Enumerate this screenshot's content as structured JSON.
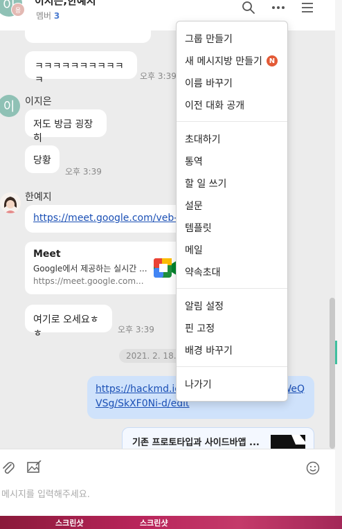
{
  "header": {
    "title": "이지은,한예지",
    "member_label": "멤버",
    "member_count": "3",
    "avatar_main": "이",
    "avatar_sub": "용"
  },
  "messages": {
    "m1_text": "ㅋㅋㅋㅋㅋㅋㅋㅋㅋㅋㅋ",
    "m1_time": "오후 3:39",
    "sender1": "이지은",
    "sender1_avatar": "이",
    "m2_text": "저도 방금 굉장히",
    "m3_text": "당황",
    "m3_time": "오후 3:39",
    "sender2": "한예지",
    "m4_link": "https://meet.google.com/veb-k",
    "preview1": {
      "title": "Meet",
      "desc": "Google에서 제공하는 실시간 ...",
      "url": "https://meet.google.com..."
    },
    "m5_text": "여기로 오세요ㅎㅎ",
    "m5_time": "오후 3:39",
    "date_divider": "2021. 2. 18.",
    "my_link_line1": "https://hackmd.io",
    "my_link_line1_tail": "WeQ",
    "my_link_line2": "VSg/SkXF0Ni-d/edit",
    "preview2_title": "기존 프로토타입과 사이드바앱 ..."
  },
  "menu": {
    "items_group1": [
      "그룹 만들기",
      "새 메시지방 만들기",
      "이름 바꾸기",
      "이전 대화 공개"
    ],
    "badge": "N",
    "items_group2": [
      "초대하기",
      "통역",
      "할 일 쓰기",
      "설문",
      "템플릿",
      "메일",
      "약속초대"
    ],
    "items_group3": [
      "알림 설정",
      "핀 고정",
      "배경 바꾸기"
    ],
    "items_group4": [
      "나가기"
    ]
  },
  "input": {
    "placeholder": "메시지를 입력해주세요."
  },
  "dock": {
    "label1": "스크린샷",
    "label2": "스크린샷"
  },
  "icons": [
    "search-icon",
    "more-icon",
    "hamburger-icon",
    "attach-icon",
    "image-edit-icon",
    "emoji-icon",
    "document-icon",
    "meet-logo-icon"
  ],
  "colors": {
    "link": "#1a4fb5",
    "my_bubble": "#cfe2fb",
    "badge": "#e35a36",
    "avatar": "#8fc1b5",
    "dock": "#b8245a"
  }
}
